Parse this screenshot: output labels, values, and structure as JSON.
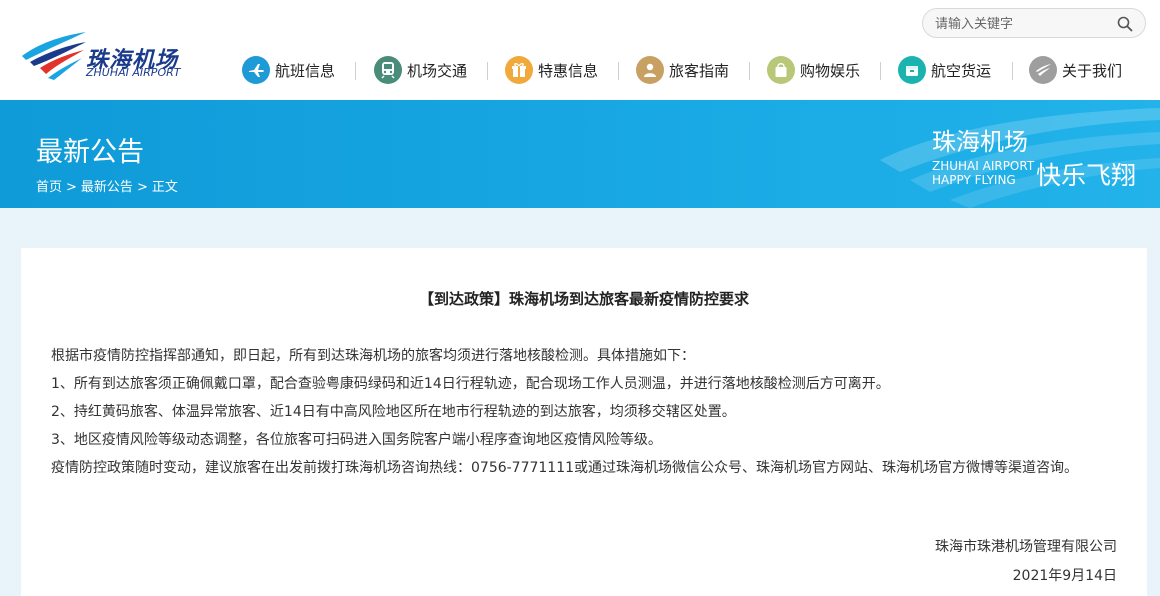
{
  "header": {
    "logo": {
      "name_cn": "珠海机场",
      "name_en": "ZHUHAI AIRPORT"
    },
    "search": {
      "placeholder": "请输入关键字",
      "icon": "search-icon"
    },
    "nav": [
      {
        "label": "航班信息",
        "icon": "airplane-icon",
        "color": "#1e9ad6"
      },
      {
        "label": "机场交通",
        "icon": "train-icon",
        "color": "#4a8c7a"
      },
      {
        "label": "特惠信息",
        "icon": "gift-icon",
        "color": "#f2a93b"
      },
      {
        "label": "旅客指南",
        "icon": "passenger-icon",
        "color": "#c8a061"
      },
      {
        "label": "购物娱乐",
        "icon": "shopping-bag-icon",
        "color": "#b8c778"
      },
      {
        "label": "航空货运",
        "icon": "cargo-box-icon",
        "color": "#1bb3b0"
      },
      {
        "label": "关于我们",
        "icon": "airport-logo-icon",
        "color": "#9e9e9e"
      }
    ]
  },
  "banner": {
    "title": "最新公告",
    "breadcrumb": [
      "首页",
      "最新公告",
      "正文"
    ],
    "breadcrumb_sep": ">",
    "brand_cn": "珠海机场",
    "brand_en_1": "ZHUHAI AIRPORT",
    "brand_en_2": "HAPPY FLYING",
    "slogan": "快乐飞翔"
  },
  "article": {
    "title": "【到达政策】珠海机场到达旅客最新疫情防控要求",
    "paragraphs": [
      "根据市疫情防控指挥部通知，即日起，所有到达珠海机场的旅客均须进行落地核酸检测。具体措施如下：",
      "1、所有到达旅客须正确佩戴口罩，配合查验粤康码绿码和近14日行程轨迹，配合现场工作人员测温，并进行落地核酸检测后方可离开。",
      "2、持红黄码旅客、体温异常旅客、近14日有中高风险地区所在地市行程轨迹的到达旅客，均须移交辖区处置。",
      "3、地区疫情风险等级动态调整，各位旅客可扫码进入国务院客户端小程序查询地区疫情风险等级。",
      "疫情防控政策随时变动，建议旅客在出发前拨打珠海机场咨询热线：0756-7771111或通过珠海机场微信公众号、珠海机场官方网站、珠海机场官方微博等渠道咨询。"
    ],
    "signature_org": "珠海市珠港机场管理有限公司",
    "signature_date": "2021年9月14日"
  },
  "colors": {
    "banner_blue": "#1aa5e0",
    "page_bg": "#e8f3fa",
    "logo_blue": "#1a3a8c",
    "logo_red": "#e2322a"
  }
}
